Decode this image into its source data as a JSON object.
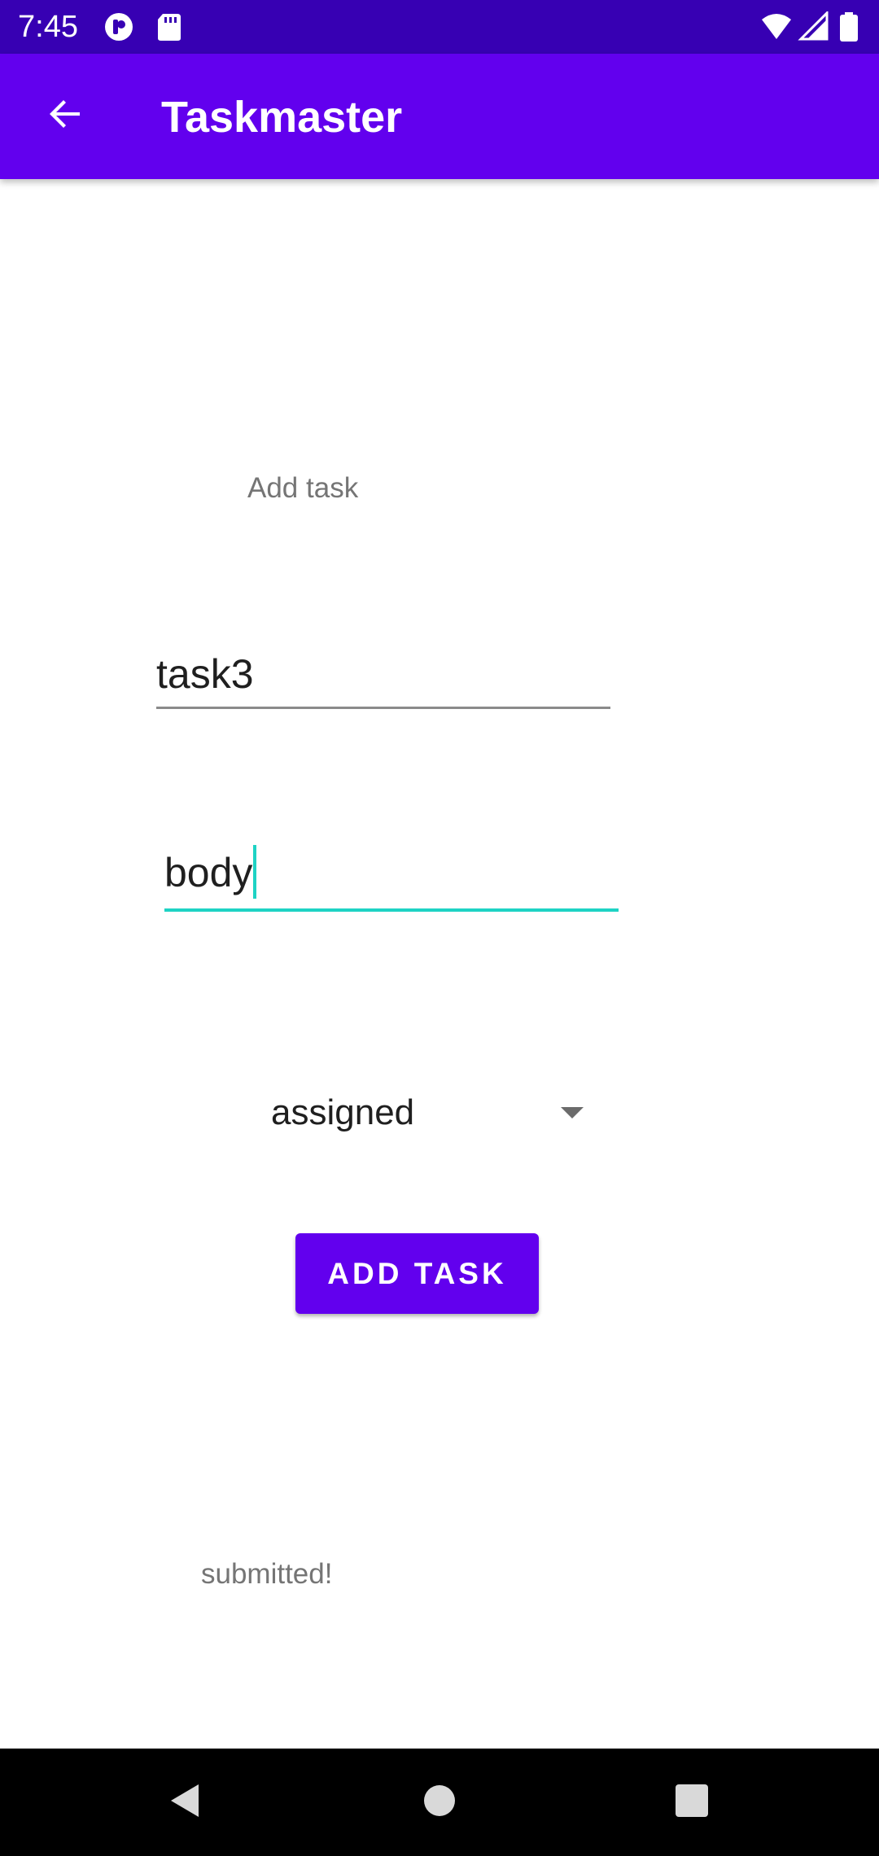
{
  "status_bar": {
    "time": "7:45",
    "left_icons": [
      "app-notification-icon",
      "sd-card-icon"
    ],
    "right_icons": [
      "wifi-icon",
      "cell-signal-icon",
      "battery-icon"
    ]
  },
  "app_bar": {
    "title": "Taskmaster",
    "back_icon": "arrow-back-icon",
    "color": "#6200ee"
  },
  "form": {
    "heading": "Add task",
    "title_input": {
      "value": "task3"
    },
    "body_input": {
      "value": "body",
      "focused": true
    },
    "spinner": {
      "selected": "assigned"
    },
    "add_button_label": "ADD TASK",
    "status_message": "submitted!"
  },
  "nav_bar": {
    "buttons": [
      "back-triangle-icon",
      "home-circle-icon",
      "recents-square-icon"
    ]
  },
  "colors": {
    "status_bar": "#3700b3",
    "primary": "#6200ee",
    "accent": "#1ed3c4"
  }
}
